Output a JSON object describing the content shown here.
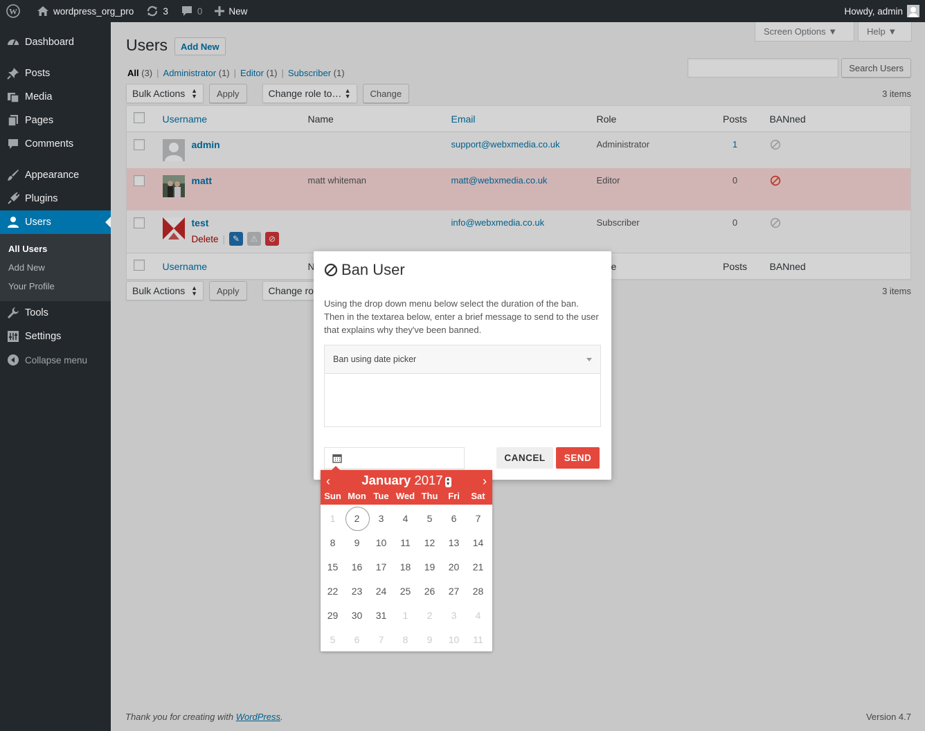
{
  "adminbar": {
    "site_name": "wordpress_org_pro",
    "updates_count": "3",
    "comments_count": "0",
    "new_label": "New",
    "howdy": "Howdy, admin"
  },
  "sidebar": {
    "items": [
      {
        "label": "Dashboard"
      },
      {
        "label": "Posts"
      },
      {
        "label": "Media"
      },
      {
        "label": "Pages"
      },
      {
        "label": "Comments"
      },
      {
        "label": "Appearance"
      },
      {
        "label": "Plugins"
      },
      {
        "label": "Users"
      },
      {
        "label": "Tools"
      },
      {
        "label": "Settings"
      },
      {
        "label": "Collapse menu"
      }
    ],
    "users_submenu": [
      "All Users",
      "Add New",
      "Your Profile"
    ]
  },
  "header": {
    "screen_options": "Screen Options ▼",
    "help": "Help ▼",
    "title": "Users",
    "add_new": "Add New"
  },
  "filters": {
    "all": "All",
    "all_count": "(3)",
    "administrator": "Administrator",
    "administrator_count": "(1)",
    "editor": "Editor",
    "editor_count": "(1)",
    "subscriber": "Subscriber",
    "subscriber_count": "(1)"
  },
  "search": {
    "button": "Search Users",
    "value": ""
  },
  "tablenav": {
    "bulk_actions": "Bulk Actions",
    "apply": "Apply",
    "change_role": "Change role to…",
    "change": "Change",
    "items": "3 items",
    "change_role_truncated": "Change rol"
  },
  "table": {
    "columns": [
      "Username",
      "Name",
      "Email",
      "Role",
      "Posts",
      "BANned"
    ],
    "rows": [
      {
        "username": "admin",
        "name": "",
        "email": "support@webxmedia.co.uk",
        "role": "Administrator",
        "posts": "1",
        "banned": false
      },
      {
        "username": "matt",
        "name": "matt whiteman",
        "email": "matt@webxmedia.co.uk",
        "role": "Editor",
        "posts": "0",
        "banned": true
      },
      {
        "username": "test",
        "name": "",
        "email": "info@webxmedia.co.uk",
        "role": "Subscriber",
        "posts": "0",
        "banned": false,
        "delete_label": "Delete"
      }
    ]
  },
  "modal": {
    "title": "Ban User",
    "description": "Using the drop down menu below select the duration of the ban. Then in the textarea below, enter a brief message to send to the user that explains why they've been banned.",
    "dropdown_value": "Ban using date picker",
    "message": "",
    "date_value": "",
    "cancel": "CANCEL",
    "send": "SEND"
  },
  "calendar": {
    "month": "January",
    "year": "2017",
    "weekdays": [
      "Sun",
      "Mon",
      "Tue",
      "Wed",
      "Thu",
      "Fri",
      "Sat"
    ],
    "weeks": [
      [
        "1",
        "2",
        "3",
        "4",
        "5",
        "6",
        "7"
      ],
      [
        "8",
        "9",
        "10",
        "11",
        "12",
        "13",
        "14"
      ],
      [
        "15",
        "16",
        "17",
        "18",
        "19",
        "20",
        "21"
      ],
      [
        "22",
        "23",
        "24",
        "25",
        "26",
        "27",
        "28"
      ],
      [
        "29",
        "30",
        "31",
        "1",
        "2",
        "3",
        "4"
      ],
      [
        "5",
        "6",
        "7",
        "8",
        "9",
        "10",
        "11"
      ]
    ],
    "selected_day": "2"
  },
  "footer": {
    "thanks_prefix": "Thank you for creating with",
    "link": "WordPress",
    "suffix": ".",
    "version": "Version 4.7"
  },
  "colors": {
    "accent": "#0073aa",
    "danger": "#e4483c",
    "banned_row": "#fcdada"
  }
}
